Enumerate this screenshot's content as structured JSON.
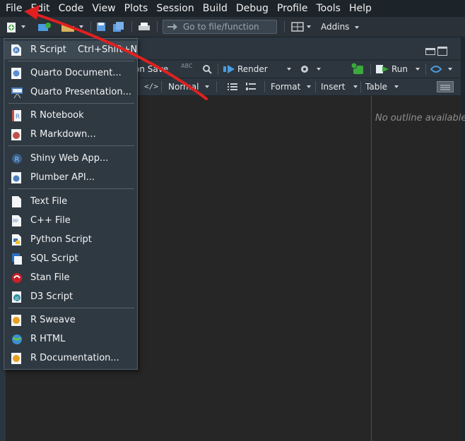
{
  "menubar": [
    "File",
    "Edit",
    "Code",
    "View",
    "Plots",
    "Session",
    "Build",
    "Debug",
    "Profile",
    "Tools",
    "Help"
  ],
  "toolbar": {
    "goto_placeholder": "Go to file/function",
    "addins_label": "Addins"
  },
  "editor_toolbar": {
    "source_on_save": "on Save",
    "spell_label": "ABC",
    "render_label": "Render",
    "run_label": "Run",
    "format_mode": "Normal",
    "format_label": "Format",
    "insert_label": "Insert",
    "table_label": "Table"
  },
  "outline": {
    "empty_text": "No outline available"
  },
  "new_file_menu": {
    "items": [
      {
        "label": "R Script",
        "shortcut": "Ctrl+Shift+N",
        "icon": "r-script-icon"
      },
      {
        "label": "Quarto Document...",
        "icon": "quarto-document-icon"
      },
      {
        "label": "Quarto Presentation...",
        "icon": "quarto-presentation-icon"
      },
      {
        "label": "R Notebook",
        "icon": "r-notebook-icon"
      },
      {
        "label": "R Markdown...",
        "icon": "r-markdown-icon"
      },
      {
        "label": "Shiny Web App...",
        "icon": "shiny-icon"
      },
      {
        "label": "Plumber API...",
        "icon": "plumber-icon"
      },
      {
        "label": "Text File",
        "icon": "text-file-icon"
      },
      {
        "label": "C++ File",
        "icon": "cpp-file-icon"
      },
      {
        "label": "Python Script",
        "icon": "python-icon"
      },
      {
        "label": "SQL Script",
        "icon": "sql-icon"
      },
      {
        "label": "Stan File",
        "icon": "stan-icon"
      },
      {
        "label": "D3 Script",
        "icon": "d3-icon"
      },
      {
        "label": "R Sweave",
        "icon": "sweave-icon"
      },
      {
        "label": "R HTML",
        "icon": "r-html-icon"
      },
      {
        "label": "R Documentation...",
        "icon": "r-documentation-icon"
      }
    ]
  },
  "colors": {
    "annotation_arrow": "#e02020",
    "accent_blue": "#4a9be0",
    "menu_bg": "#2f3942"
  }
}
